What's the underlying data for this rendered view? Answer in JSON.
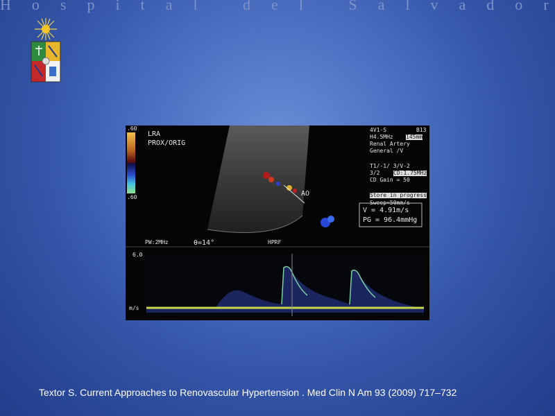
{
  "slide": {
    "header_title": "Hospital del Salvador",
    "caption": "Textor S. Current Approaches to Renovascular Hypertension . Med Clin N Am 93 (2009) 717–732"
  },
  "logo": {
    "icon": "university-crest-icon"
  },
  "ultrasound": {
    "location_line1": "LRA",
    "location_line2": "PROX/ORIG",
    "scale_top": ".60",
    "scale_bottom": ".60",
    "probe_line1": "4V1-S",
    "frame_number": "B13",
    "freq": "H4.5MHz",
    "depth": "145mm",
    "preset_line1": "Renal Artery",
    "preset_line2": "General /V",
    "settings_line1": "T1/-1/ 3/V-2",
    "settings_line2a": "3/2",
    "cd_freq": "CD:1.75MHz",
    "cd_gain": "CD Gain = 50",
    "store_status": "Store in progress",
    "sweep": "Sweep=50mm/s",
    "velocity": "V = 4.91m/s",
    "pressure_gradient": "PG = 96.4mmHg",
    "vessel_label": "AO",
    "pw_label": "PW:2MHz",
    "angle": "θ=14°",
    "mode": "HPRF",
    "spectral_top": "6.0",
    "spectral_unit": "m/s"
  }
}
